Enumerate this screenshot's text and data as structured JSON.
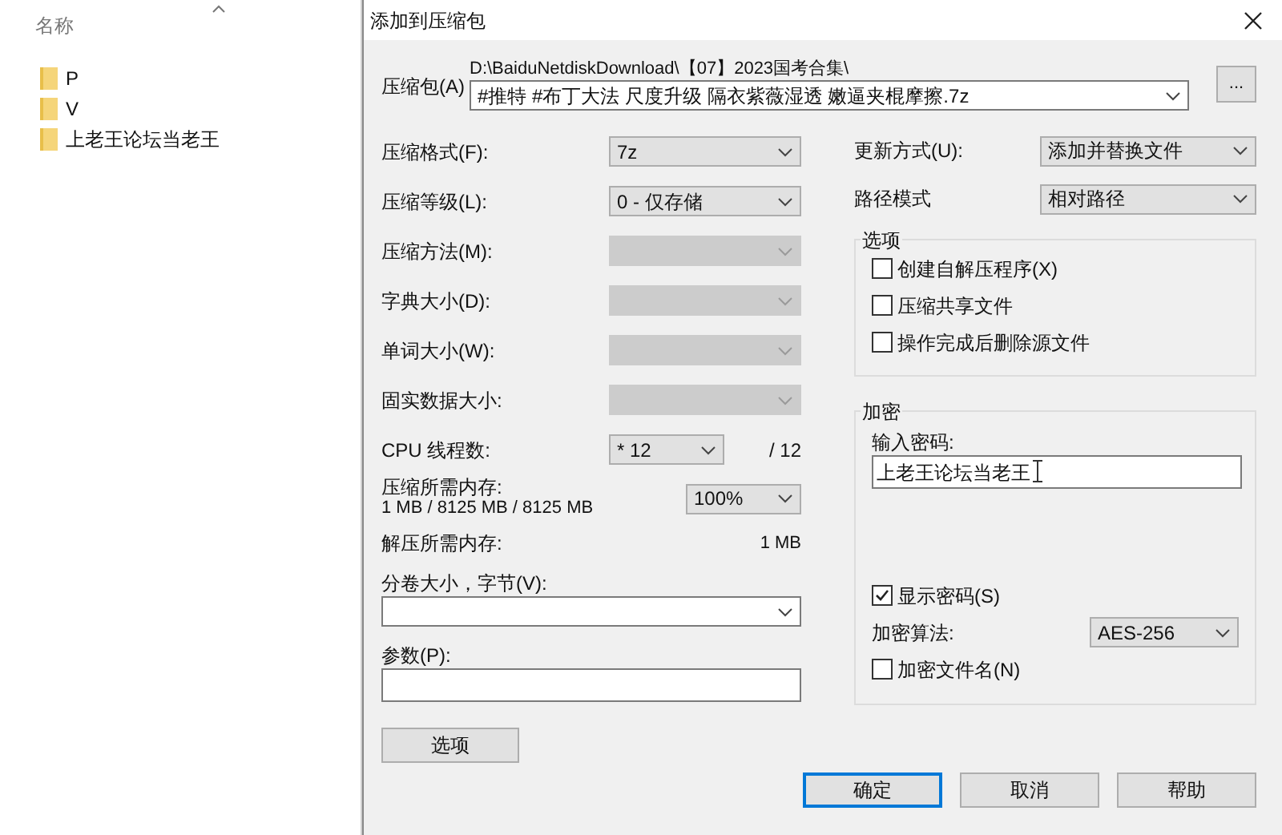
{
  "explorer": {
    "column_header": "名称",
    "items": [
      {
        "name": "P"
      },
      {
        "name": "V"
      },
      {
        "name": "上老王论坛当老王"
      }
    ]
  },
  "dialog": {
    "title": "添加到压缩包",
    "archive": {
      "label": "压缩包(A)",
      "path": "D:\\BaiduNetdiskDownload\\【07】2023国考合集\\",
      "filename": "#推特 #布丁大法 尺度升级 隔衣紫薇湿透 嫩逼夹棍摩擦.7z",
      "browse": "..."
    },
    "left_fields": [
      {
        "label": "压缩格式(F):",
        "value": "7z",
        "disabled": false
      },
      {
        "label": "压缩等级(L):",
        "value": "0 - 仅存储",
        "disabled": false
      },
      {
        "label": "压缩方法(M):",
        "disabled": true
      },
      {
        "label": "字典大小(D):",
        "disabled": true
      },
      {
        "label": "单词大小(W):",
        "disabled": true
      },
      {
        "label": "固实数据大小:",
        "disabled": true
      }
    ],
    "threads": {
      "label": "CPU 线程数:",
      "value": "* 12",
      "max": "/ 12"
    },
    "memory": {
      "label": "压缩所需内存:",
      "detail": "1 MB / 8125 MB / 8125 MB",
      "value": "100%"
    },
    "decompress_memory": {
      "label": "解压所需内存:",
      "value": "1 MB"
    },
    "volume": {
      "label": "分卷大小，字节(V):"
    },
    "parameters": {
      "label": "参数(P):"
    },
    "options_button": "选项",
    "right_fields": [
      {
        "label": "更新方式(U):",
        "value": "添加并替换文件"
      },
      {
        "label": "路径模式",
        "value": "相对路径"
      }
    ],
    "options_group": {
      "title": "选项",
      "items": [
        {
          "label": "创建自解压程序(X)",
          "checked": false
        },
        {
          "label": "压缩共享文件",
          "checked": false
        },
        {
          "label": "操作完成后删除源文件",
          "checked": false
        }
      ]
    },
    "encryption": {
      "title": "加密",
      "password_label": "输入密码:",
      "password": "上老王论坛当老王",
      "show_password": {
        "label": "显示密码(S)",
        "checked": true
      },
      "algorithm": {
        "label": "加密算法:",
        "value": "AES-256"
      },
      "encrypt_names": {
        "label": "加密文件名(N)",
        "checked": false
      }
    },
    "buttons": [
      {
        "label": "确定",
        "default": true
      },
      {
        "label": "取消",
        "default": false
      },
      {
        "label": "帮助",
        "default": false
      }
    ]
  }
}
